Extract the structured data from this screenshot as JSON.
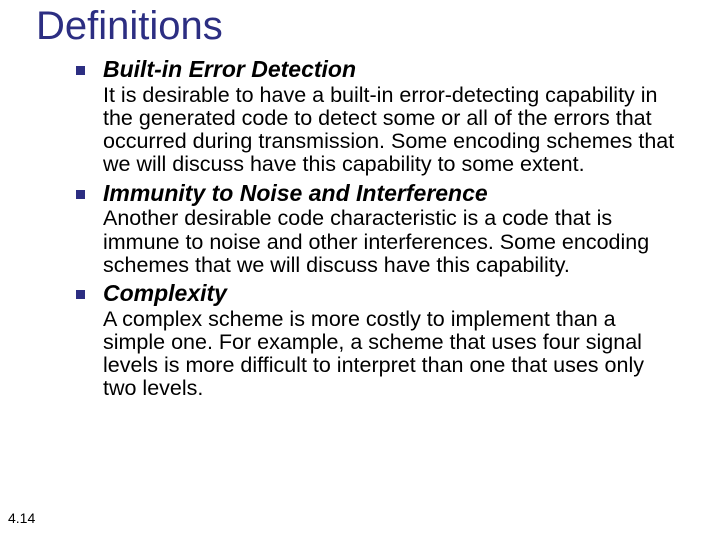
{
  "title": "Definitions",
  "items": [
    {
      "heading": "Built-in Error Detection",
      "body": "It is desirable to have a built-in error-detecting capability in the generated code to detect some or all of the errors that occurred during transmission. Some encoding schemes that we will discuss have this capability to some extent."
    },
    {
      "heading": "Immunity to Noise and Interference",
      "body": "Another desirable code characteristic is a code that is immune to noise and other interferences. Some encoding schemes that we will discuss have this capability."
    },
    {
      "heading": "Complexity",
      "body": "A complex scheme is more costly to implement than a simple one. For example, a scheme that uses four signal levels is more difficult to interpret than one that uses only two levels."
    }
  ],
  "page_number": "4.14"
}
